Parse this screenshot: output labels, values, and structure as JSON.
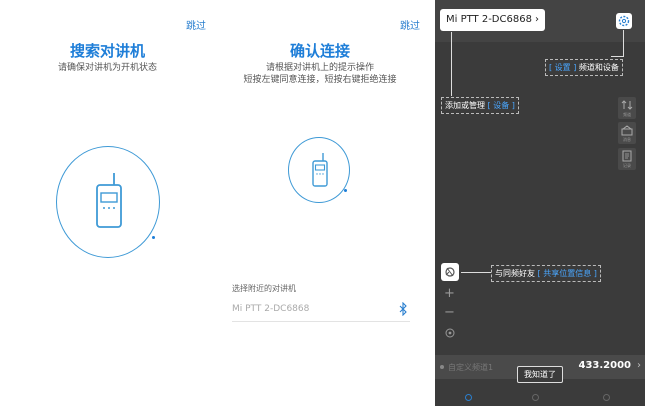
{
  "screens": {
    "search": {
      "skip_label": "跳过",
      "title": "搜索对讲机",
      "subtitle": "请确保对讲机为开机状态"
    },
    "connect": {
      "skip_label": "跳过",
      "title": "确认连接",
      "subtitle_line1": "请根据对讲机上的提示操作",
      "subtitle_line2": "短按左键同意连接，短按右键拒绝连接",
      "nearby_label": "选择附近的对讲机",
      "device_name": "Mi PTT 2-DC6868"
    },
    "map": {
      "device_chip": "Mi PTT 2-DC6868",
      "tip_settings_hl": "[ 设置 ]",
      "tip_settings_text": "频道和设备",
      "tip_add_text": "添加或管理",
      "tip_add_hl": "[ 设备 ]",
      "tip_share_text": "与同频好友",
      "tip_share_hl": "[ 共享位置信息 ]",
      "side_buttons": [
        "频道",
        "消息",
        "记录"
      ],
      "zoom_in": "+",
      "zoom_out": "−",
      "channel_name": "自定义频道1",
      "frequency": "433.2000",
      "got_it": "我知道了"
    }
  },
  "colors": {
    "accent": "#1e7ed8",
    "dark_bg": "#3b3b3b",
    "highlight": "#4aa7ff"
  }
}
